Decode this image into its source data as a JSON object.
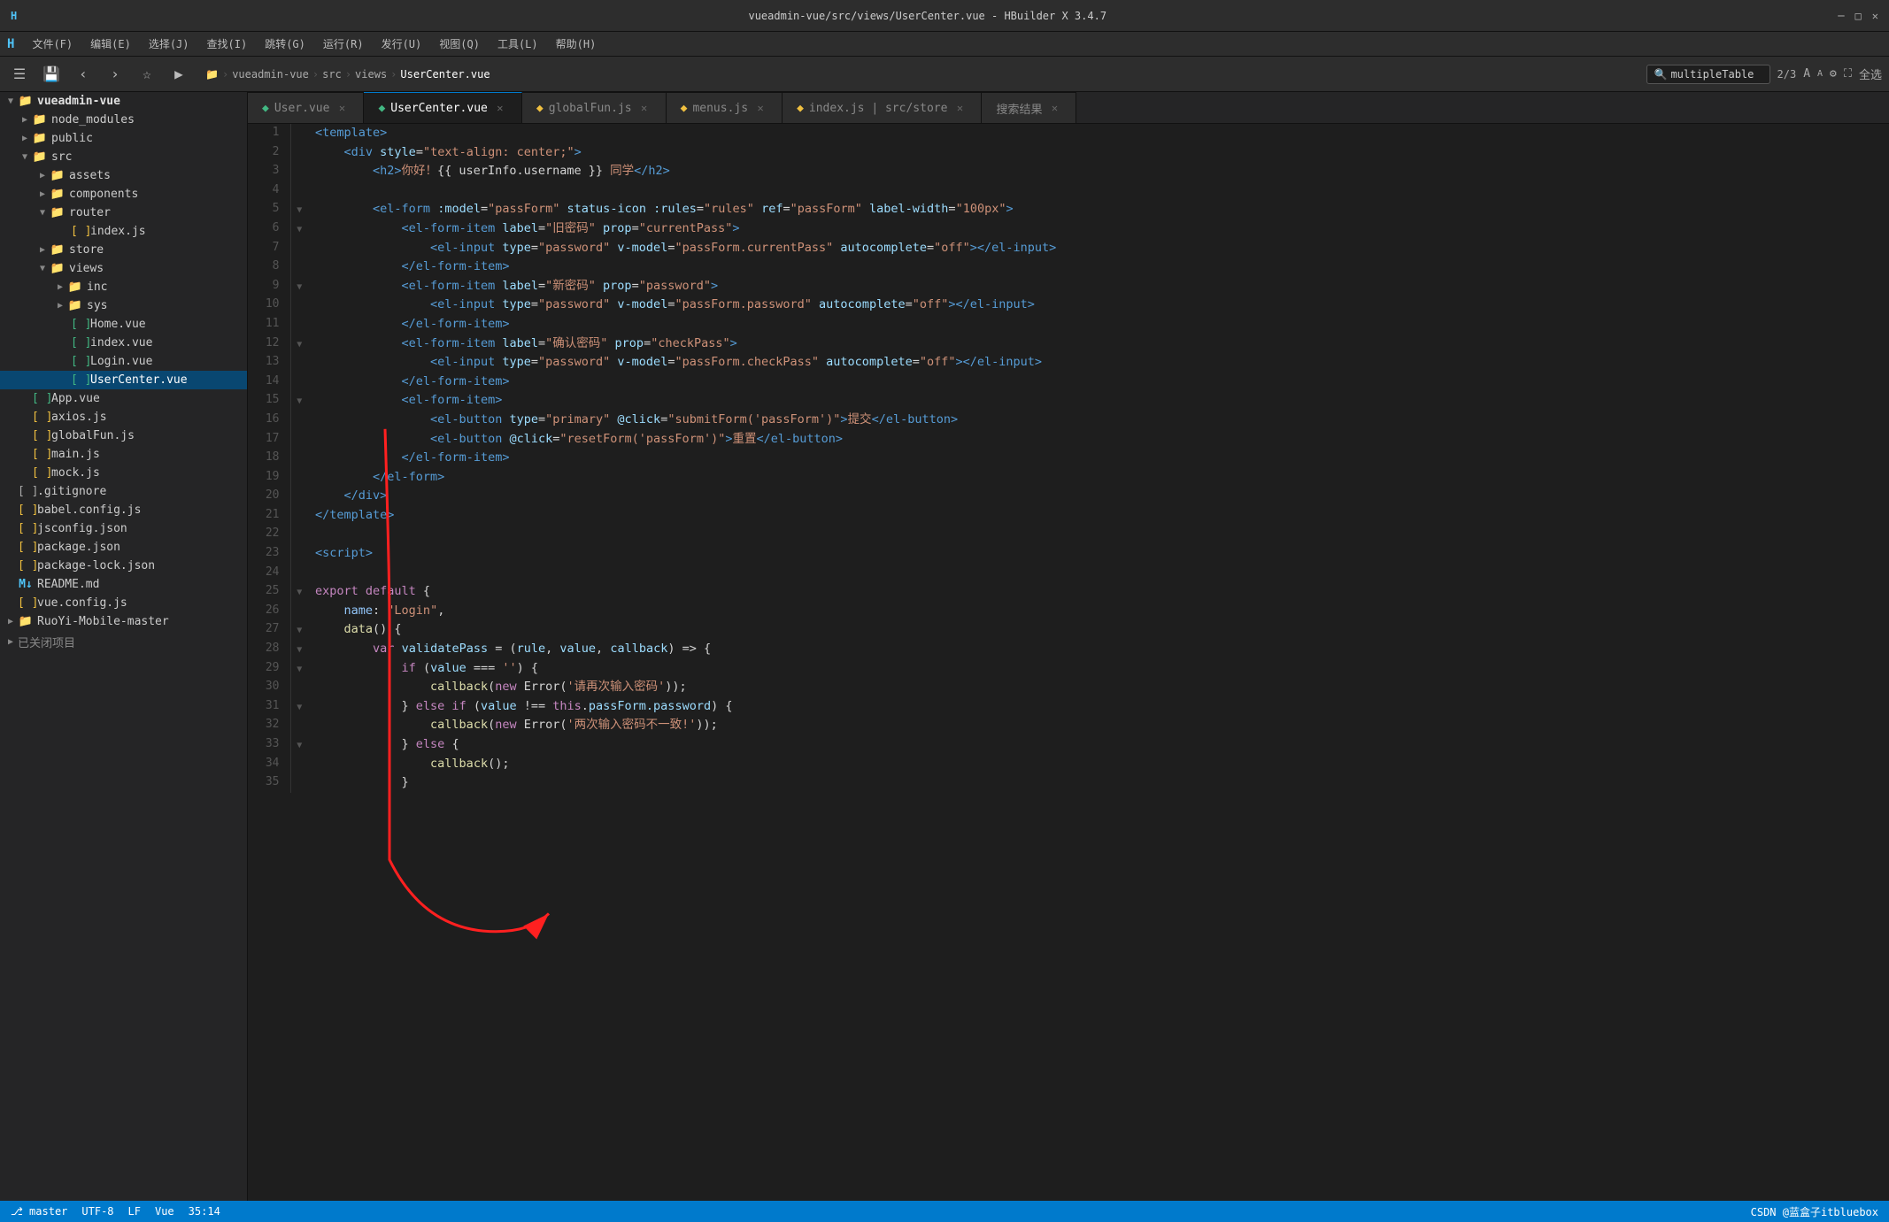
{
  "window": {
    "title": "vueadmin-vue/src/views/UserCenter.vue - HBuilder X 3.4.7"
  },
  "menubar": {
    "items": [
      "文件(F)",
      "编辑(E)",
      "选择(J)",
      "查找(I)",
      "跳转(G)",
      "运行(R)",
      "发行(U)",
      "视图(Q)",
      "工具(L)",
      "帮助(H)"
    ]
  },
  "toolbar": {
    "search_box": "multipleTable",
    "breadcrumb": [
      "vueadmin-vue",
      "src",
      "views",
      "UserCenter.vue"
    ],
    "page_info": "2/3"
  },
  "tabs": [
    {
      "label": "User.vue",
      "active": false
    },
    {
      "label": "UserCenter.vue",
      "active": true
    },
    {
      "label": "globalFun.js",
      "active": false
    },
    {
      "label": "menus.js",
      "active": false
    },
    {
      "label": "index.js | src/store",
      "active": false
    },
    {
      "label": "搜索结果",
      "active": false
    }
  ],
  "sidebar": {
    "root": "vueadmin-vue",
    "items": [
      {
        "type": "folder",
        "name": "node_modules",
        "level": 1,
        "expanded": false
      },
      {
        "type": "folder",
        "name": "public",
        "level": 1,
        "expanded": false
      },
      {
        "type": "folder",
        "name": "src",
        "level": 1,
        "expanded": true
      },
      {
        "type": "folder",
        "name": "assets",
        "level": 2,
        "expanded": false
      },
      {
        "type": "folder",
        "name": "components",
        "level": 2,
        "expanded": false
      },
      {
        "type": "folder",
        "name": "router",
        "level": 2,
        "expanded": true
      },
      {
        "type": "file",
        "name": "index.js",
        "level": 3,
        "filetype": "js"
      },
      {
        "type": "folder",
        "name": "store",
        "level": 2,
        "expanded": false
      },
      {
        "type": "folder",
        "name": "views",
        "level": 2,
        "expanded": true
      },
      {
        "type": "folder",
        "name": "inc",
        "level": 3,
        "expanded": false
      },
      {
        "type": "folder",
        "name": "sys",
        "level": 3,
        "expanded": false
      },
      {
        "type": "file",
        "name": "Home.vue",
        "level": 3,
        "filetype": "vue"
      },
      {
        "type": "file",
        "name": "index.vue",
        "level": 3,
        "filetype": "vue"
      },
      {
        "type": "file",
        "name": "Login.vue",
        "level": 3,
        "filetype": "vue"
      },
      {
        "type": "file",
        "name": "UserCenter.vue",
        "level": 3,
        "filetype": "vue",
        "selected": true
      },
      {
        "type": "file",
        "name": "App.vue",
        "level": 1,
        "filetype": "vue"
      },
      {
        "type": "file",
        "name": "axios.js",
        "level": 1,
        "filetype": "js"
      },
      {
        "type": "file",
        "name": "globalFun.js",
        "level": 1,
        "filetype": "js"
      },
      {
        "type": "file",
        "name": "main.js",
        "level": 1,
        "filetype": "js"
      },
      {
        "type": "file",
        "name": "mock.js",
        "level": 1,
        "filetype": "js"
      },
      {
        "type": "file",
        "name": ".gitignore",
        "level": 0,
        "filetype": "git"
      },
      {
        "type": "file",
        "name": "babel.config.js",
        "level": 0,
        "filetype": "js"
      },
      {
        "type": "file",
        "name": "jsconfig.json",
        "level": 0,
        "filetype": "json"
      },
      {
        "type": "file",
        "name": "package.json",
        "level": 0,
        "filetype": "json"
      },
      {
        "type": "file",
        "name": "package-lock.json",
        "level": 0,
        "filetype": "json"
      },
      {
        "type": "file",
        "name": "README.md",
        "level": 0,
        "filetype": "md"
      },
      {
        "type": "file",
        "name": "vue.config.js",
        "level": 0,
        "filetype": "js"
      },
      {
        "type": "folder",
        "name": "RuoYi-Mobile-master",
        "level": 0,
        "expanded": false
      },
      {
        "type": "section",
        "name": "已关闭项目"
      }
    ]
  },
  "code_lines": [
    {
      "num": 1,
      "fold": false,
      "content_html": "<span class='tag'>&lt;template&gt;</span>"
    },
    {
      "num": 2,
      "fold": false,
      "content_html": "    <span class='tag'>&lt;div</span> <span class='attr'>style</span><span class='op'>=</span><span class='str'>\"text-align: center;\"</span><span class='tag'>&gt;</span>"
    },
    {
      "num": 3,
      "fold": false,
      "content_html": "        <span class='tag'>&lt;h2&gt;</span><span class='cn-text'>你好！</span>{{ userInfo.username }} <span class='cn-text'>同学</span><span class='tag'>&lt;/h2&gt;</span>"
    },
    {
      "num": 4,
      "fold": false,
      "content_html": ""
    },
    {
      "num": 5,
      "fold": true,
      "content_html": "        <span class='tag'>&lt;el-form</span> <span class='attr'>:model</span><span class='op'>=</span><span class='str'>\"passForm\"</span> <span class='attr'>status-icon</span> <span class='attr'>:rules</span><span class='op'>=</span><span class='str'>\"rules\"</span> <span class='attr'>ref</span><span class='op'>=</span><span class='str'>\"passForm\"</span> <span class='attr'>label-width</span><span class='op'>=</span><span class='str'>\"100px\"</span><span class='tag'>&gt;</span>"
    },
    {
      "num": 6,
      "fold": true,
      "content_html": "            <span class='tag'>&lt;el-form-item</span> <span class='attr'>label</span><span class='op'>=</span><span class='str'>\"旧密码\"</span> <span class='attr'>prop</span><span class='op'>=</span><span class='str'>\"currentPass\"</span><span class='tag'>&gt;</span>"
    },
    {
      "num": 7,
      "fold": false,
      "content_html": "                <span class='tag'>&lt;el-input</span> <span class='attr'>type</span><span class='op'>=</span><span class='str'>\"password\"</span> <span class='attr'>v-model</span><span class='op'>=</span><span class='str'>\"passForm.currentPass\"</span> <span class='attr'>autocomplete</span><span class='op'>=</span><span class='str'>\"off\"</span><span class='tag'>&gt;&lt;/el-input&gt;</span>"
    },
    {
      "num": 8,
      "fold": false,
      "content_html": "            <span class='tag'>&lt;/el-form-item&gt;</span>"
    },
    {
      "num": 9,
      "fold": true,
      "content_html": "            <span class='tag'>&lt;el-form-item</span> <span class='attr'>label</span><span class='op'>=</span><span class='str'>\"新密码\"</span> <span class='attr'>prop</span><span class='op'>=</span><span class='str'>\"password\"</span><span class='tag'>&gt;</span>"
    },
    {
      "num": 10,
      "fold": false,
      "content_html": "                <span class='tag'>&lt;el-input</span> <span class='attr'>type</span><span class='op'>=</span><span class='str'>\"password\"</span> <span class='attr'>v-model</span><span class='op'>=</span><span class='str'>\"passForm.password\"</span> <span class='attr'>autocomplete</span><span class='op'>=</span><span class='str'>\"off\"</span><span class='tag'>&gt;&lt;/el-input&gt;</span>"
    },
    {
      "num": 11,
      "fold": false,
      "content_html": "            <span class='tag'>&lt;/el-form-item&gt;</span>"
    },
    {
      "num": 12,
      "fold": true,
      "content_html": "            <span class='tag'>&lt;el-form-item</span> <span class='attr'>label</span><span class='op'>=</span><span class='str'>\"确认密码\"</span> <span class='attr'>prop</span><span class='op'>=</span><span class='str'>\"checkPass\"</span><span class='tag'>&gt;</span>"
    },
    {
      "num": 13,
      "fold": false,
      "content_html": "                <span class='tag'>&lt;el-input</span> <span class='attr'>type</span><span class='op'>=</span><span class='str'>\"password\"</span> <span class='attr'>v-model</span><span class='op'>=</span><span class='str'>\"passForm.checkPass\"</span> <span class='attr'>autocomplete</span><span class='op'>=</span><span class='str'>\"off\"</span><span class='tag'>&gt;&lt;/el-input&gt;</span>"
    },
    {
      "num": 14,
      "fold": false,
      "content_html": "            <span class='tag'>&lt;/el-form-item&gt;</span>"
    },
    {
      "num": 15,
      "fold": true,
      "content_html": "            <span class='tag'>&lt;el-form-item&gt;</span>"
    },
    {
      "num": 16,
      "fold": false,
      "content_html": "                <span class='tag'>&lt;el-button</span> <span class='attr'>type</span><span class='op'>=</span><span class='str'>\"primary\"</span> <span class='attr'>@click</span><span class='op'>=</span><span class='str'>\"submitForm('passForm')\"</span><span class='tag'>&gt;</span><span class='cn-text'>提交</span><span class='tag'>&lt;/el-button&gt;</span>"
    },
    {
      "num": 17,
      "fold": false,
      "content_html": "                <span class='tag'>&lt;el-button</span> <span class='attr'>@click</span><span class='op'>=</span><span class='str'>\"resetForm('passForm')\"</span><span class='tag'>&gt;</span><span class='cn-text'>重置</span><span class='tag'>&lt;/el-button&gt;</span>"
    },
    {
      "num": 18,
      "fold": false,
      "content_html": "            <span class='tag'>&lt;/el-form-item&gt;</span>"
    },
    {
      "num": 19,
      "fold": false,
      "content_html": "        <span class='tag'>&lt;/el-form&gt;</span>"
    },
    {
      "num": 20,
      "fold": false,
      "content_html": "    <span class='tag'>&lt;/div&gt;</span>"
    },
    {
      "num": 21,
      "fold": false,
      "content_html": "<span class='tag'>&lt;/template&gt;</span>"
    },
    {
      "num": 22,
      "fold": false,
      "content_html": ""
    },
    {
      "num": 23,
      "fold": false,
      "content_html": "<span class='tag'>&lt;script&gt;</span>"
    },
    {
      "num": 24,
      "fold": false,
      "content_html": ""
    },
    {
      "num": 25,
      "fold": true,
      "content_html": "<span class='kw'>export default</span> {"
    },
    {
      "num": 26,
      "fold": false,
      "content_html": "    <span class='prop-name'>name</span>: <span class='str'>\"Login\"</span>,"
    },
    {
      "num": 27,
      "fold": true,
      "content_html": "    <span class='fn'>data</span>() {"
    },
    {
      "num": 28,
      "fold": true,
      "content_html": "        <span class='kw'>var</span> <span class='var'>validatePass</span> = (<span class='var'>rule</span>, <span class='var'>value</span>, <span class='var'>callback</span>) => {"
    },
    {
      "num": 29,
      "fold": true,
      "content_html": "            <span class='kw'>if</span> (<span class='var'>value</span> === <span class='str'>''</span>) {"
    },
    {
      "num": 30,
      "fold": false,
      "content_html": "                <span class='fn'>callback</span>(<span class='kw'>new</span> Error(<span class='str'>'请再次输入密码'</span>));"
    },
    {
      "num": 31,
      "fold": true,
      "content_html": "            } <span class='kw'>else if</span> (<span class='var'>value</span> !== <span class='kw'>this</span>.<span class='var'>passForm.password</span>) {"
    },
    {
      "num": 32,
      "fold": false,
      "content_html": "                <span class='fn'>callback</span>(<span class='kw'>new</span> Error(<span class='str'>'两次输入密码不一致!'</span>));"
    },
    {
      "num": 33,
      "fold": true,
      "content_html": "            } <span class='kw'>else</span> {"
    },
    {
      "num": 34,
      "fold": false,
      "content_html": "                <span class='fn'>callback</span>();"
    },
    {
      "num": 35,
      "fold": false,
      "content_html": "            }"
    }
  ],
  "status_bar": {
    "branch": "master",
    "encoding": "UTF-8",
    "line_ending": "LF",
    "file_type": "Vue",
    "position": "35:14",
    "watermark": "CSDN @蓝盒子itbluebox"
  }
}
